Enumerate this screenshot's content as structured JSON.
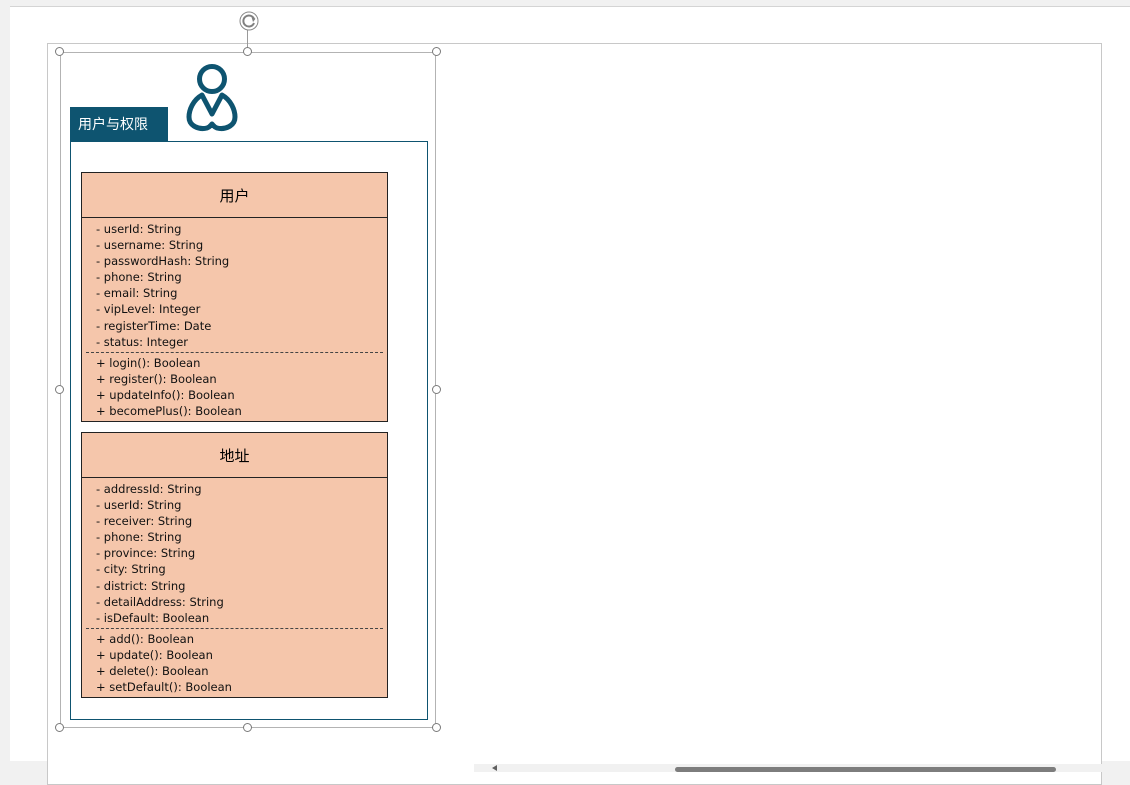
{
  "package": {
    "title": "用户与权限",
    "icon": "person-icon",
    "color": "#0e5470"
  },
  "classes": [
    {
      "name": "用户",
      "attributes": [
        "- userId: String",
        "- username: String",
        "- passwordHash: String",
        "- phone: String",
        "- email: String",
        "- vipLevel: Integer",
        "- registerTime: Date",
        "- status: Integer"
      ],
      "methods": [
        "+ login(): Boolean",
        "+ register(): Boolean",
        "+ updateInfo(): Boolean",
        "+ becomePlus(): Boolean"
      ]
    },
    {
      "name": "地址",
      "attributes": [
        "- addressId: String",
        "- userId: String",
        "- receiver: String",
        "- phone: String",
        "- province: String",
        "- city: String",
        "- district: String",
        "- detailAddress: String",
        "- isDefault: Boolean"
      ],
      "methods": [
        "+ add(): Boolean",
        "+ update(): Boolean",
        "+ delete(): Boolean",
        "+ setDefault(): Boolean"
      ]
    }
  ],
  "colors": {
    "class_fill": "#f5c6ab",
    "package": "#0e5470"
  },
  "icons": [
    "rotate-icon",
    "person-icon",
    "scroll-left-icon"
  ]
}
